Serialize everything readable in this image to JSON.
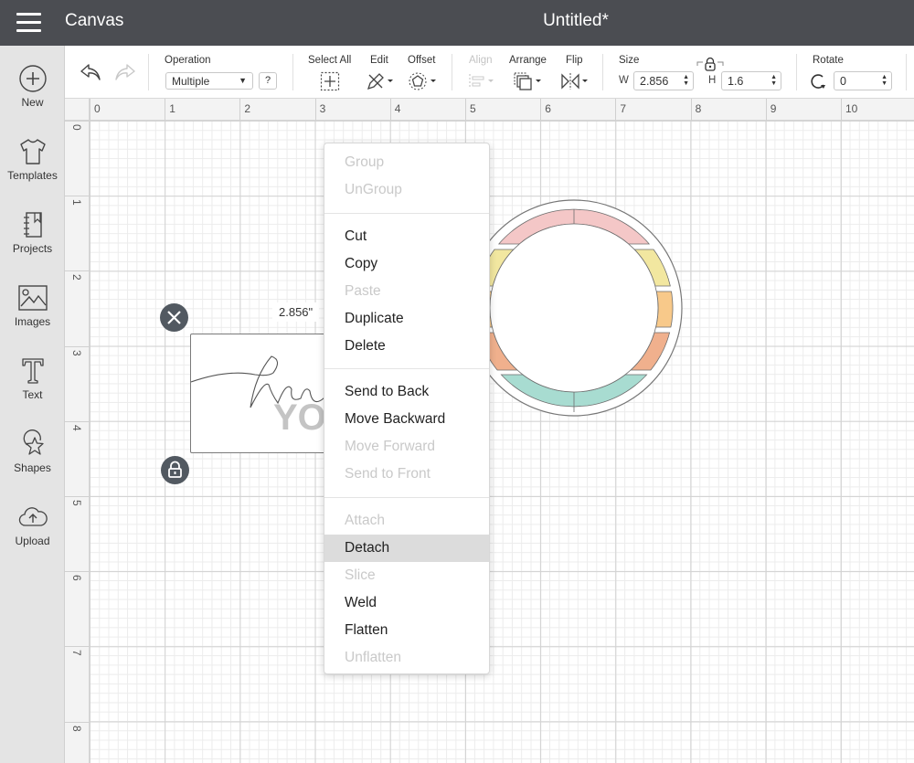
{
  "header": {
    "app_title": "Canvas",
    "doc_title": "Untitled*",
    "menu_icon": "hamburger-icon"
  },
  "sidebar": {
    "items": [
      {
        "label": "New",
        "icon": "plus-circle-icon"
      },
      {
        "label": "Templates",
        "icon": "tshirt-icon"
      },
      {
        "label": "Projects",
        "icon": "notebook-icon"
      },
      {
        "label": "Images",
        "icon": "image-icon"
      },
      {
        "label": "Text",
        "icon": "text-icon"
      },
      {
        "label": "Shapes",
        "icon": "shapes-icon"
      },
      {
        "label": "Upload",
        "icon": "cloud-upload-icon"
      }
    ]
  },
  "toolbar": {
    "undo_icon": "undo-icon",
    "redo_icon": "redo-icon",
    "operation_label": "Operation",
    "operation_value": "Multiple",
    "help_label": "?",
    "select_all_label": "Select All",
    "edit_label": "Edit",
    "offset_label": "Offset",
    "align_label": "Align",
    "arrange_label": "Arrange",
    "flip_label": "Flip",
    "size_label": "Size",
    "width_prefix": "W",
    "width_value": "2.856",
    "height_prefix": "H",
    "height_value": "1.6",
    "rotate_label": "Rotate",
    "rotate_value": "0"
  },
  "rulers": {
    "horizontal": [
      "0",
      "1",
      "2",
      "3",
      "4",
      "5",
      "6",
      "7",
      "8",
      "9",
      "10"
    ],
    "vertical": [
      "0",
      "1",
      "2",
      "3",
      "4",
      "5",
      "6",
      "7",
      "8"
    ]
  },
  "canvas": {
    "selection_width_label": "2.856\"",
    "card_text_script": "thank",
    "card_text_block": "YOU",
    "wreath_colors": [
      "#f4c7c7",
      "#f2e7a0",
      "#f8c98a",
      "#f0b08d",
      "#a8dcd1"
    ]
  },
  "context_menu": {
    "items": [
      {
        "label": "Group",
        "enabled": false
      },
      {
        "label": "UnGroup",
        "enabled": false
      },
      {
        "label": "Cut",
        "enabled": true
      },
      {
        "label": "Copy",
        "enabled": true
      },
      {
        "label": "Paste",
        "enabled": false
      },
      {
        "label": "Duplicate",
        "enabled": true
      },
      {
        "label": "Delete",
        "enabled": true
      },
      {
        "label": "Send to Back",
        "enabled": true
      },
      {
        "label": "Move Backward",
        "enabled": true
      },
      {
        "label": "Move Forward",
        "enabled": false
      },
      {
        "label": "Send to Front",
        "enabled": false
      },
      {
        "label": "Attach",
        "enabled": false
      },
      {
        "label": "Detach",
        "enabled": true,
        "highlighted": true
      },
      {
        "label": "Slice",
        "enabled": false
      },
      {
        "label": "Weld",
        "enabled": true
      },
      {
        "label": "Flatten",
        "enabled": true
      },
      {
        "label": "Unflatten",
        "enabled": false
      }
    ]
  }
}
